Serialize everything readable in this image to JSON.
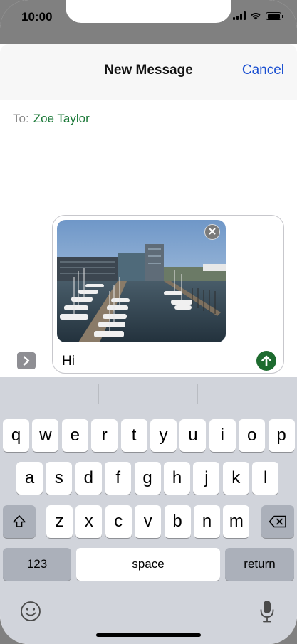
{
  "status": {
    "time": "10:00"
  },
  "nav": {
    "title": "New Message",
    "cancel": "Cancel"
  },
  "recipient": {
    "label": "To:",
    "name": "Zoe Taylor"
  },
  "compose": {
    "text": "Hi"
  },
  "keyboard": {
    "row1": [
      "q",
      "w",
      "e",
      "r",
      "t",
      "y",
      "u",
      "i",
      "o",
      "p"
    ],
    "row2": [
      "a",
      "s",
      "d",
      "f",
      "g",
      "h",
      "j",
      "k",
      "l"
    ],
    "row3": [
      "z",
      "x",
      "c",
      "v",
      "b",
      "n",
      "m"
    ],
    "numbers": "123",
    "space": "space",
    "return": "return"
  },
  "colors": {
    "accent_blue": "#1a4fd1",
    "send_green": "#1d6b2f",
    "recipient_green": "#1d7a3a"
  },
  "icons": [
    "close-icon",
    "send-arrow-icon",
    "chevron-right-icon",
    "shift-icon",
    "backspace-icon",
    "emoji-icon",
    "microphone-icon"
  ]
}
